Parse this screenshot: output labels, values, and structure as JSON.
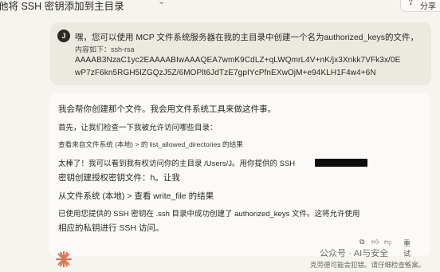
{
  "header": {
    "title": "他将 SSH 密钥添加到主目录",
    "share_label": "分享",
    "share_icon": "share-icon",
    "title_menu_icon": "chevron-down-icon"
  },
  "user_message": {
    "avatar_initial": "J",
    "line1": "嘿，您可以使用 MCP 文件系统服务器在我的主目录中创建一个名为authorized_keys的文件，",
    "line2": "内容如下：ssh-rsa",
    "line3": "AAAAB3NzaC1yc2EAAAABIwAAAQEA7wmK9CdLZ+qLWQmrL4V+nK/jx3Xnkk7VFk3x/0E",
    "line4": "wP7zF6kn5RGH5lZGQzJ5Z/6MOPlt6JdTzE7gpIYcPfnEXwOjM+e94KLH1F4w4+6N"
  },
  "assistant_message": {
    "line1": "我会帮你创建那个文件。我会用文件系统工具来做这件事。",
    "line2": "首先，让我们检查一下我被允许访问哪些目录：",
    "line3": "查看来自文件系统 (本地) > 的 list_allowed_directories 的结果",
    "line4": "太棒了！我可以看到我有权访问你的主目录 /Users/J。用你提供的 SSH",
    "line5": "密钥创建授权密钥文件：h。让我",
    "line6": "从文件系统 (本地) > 查看 write_file 的结果",
    "line7": "已使用您提供的 SSH 密钥在 .ssh 目录中成功创建了 authorized_keys 文件。这将允许使用",
    "line8": "相应的私钥进行 SSH 访问。"
  },
  "message_actions": {
    "copy_icon": "copy-icon",
    "thumbs_up_icon": "thumbs-up-icon",
    "thumbs_down_icon": "thumbs-down-icon",
    "retry_label": "重试",
    "retry_icon": "chevron-down-icon"
  },
  "watermark": {
    "line1": "公众号 · AI与安全",
    "line2": "克劳德可能会犯错。请仔细检查答案。"
  },
  "colors": {
    "background": "#f5f4ef",
    "user_bubble": "#ece9e1",
    "assistant_bubble": "#fbfaf8",
    "accent": "#d97757"
  }
}
